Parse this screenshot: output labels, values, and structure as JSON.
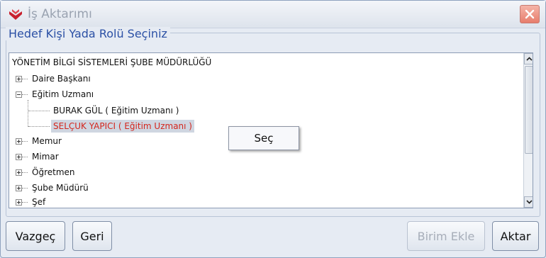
{
  "window": {
    "title": "İş Aktarımı",
    "colors": {
      "accent": "#2b50a5",
      "selected_text": "#d4261d",
      "close": "#e77d6c"
    }
  },
  "group": {
    "legend": "Hedef Kişi Yada Rolü Seçiniz"
  },
  "tree": {
    "root": "YÖNETİM BİLGİ SİSTEMLERİ ŞUBE MÜDÜRLÜĞÜ",
    "nodes": [
      {
        "label": "Daire Başkanı",
        "state": "collapsed"
      },
      {
        "label": "Eğitim Uzmanı",
        "state": "expanded",
        "children": [
          {
            "label": "BURAK GÜL ( Eğitim Uzmanı )"
          },
          {
            "label": "SELÇUK YAPICI ( Eğitim Uzmanı )",
            "selected": true
          }
        ]
      },
      {
        "label": "Memur",
        "state": "collapsed"
      },
      {
        "label": "Mimar",
        "state": "collapsed"
      },
      {
        "label": "Öğretmen",
        "state": "collapsed"
      },
      {
        "label": "Şube Müdürü",
        "state": "collapsed"
      },
      {
        "label": "Şef",
        "state": "collapsed"
      }
    ]
  },
  "context_menu": {
    "items": [
      "Seç"
    ]
  },
  "buttons": {
    "cancel": "Vazgeç",
    "back": "Geri",
    "add_unit": "Birim Ekle",
    "transfer": "Aktar"
  }
}
